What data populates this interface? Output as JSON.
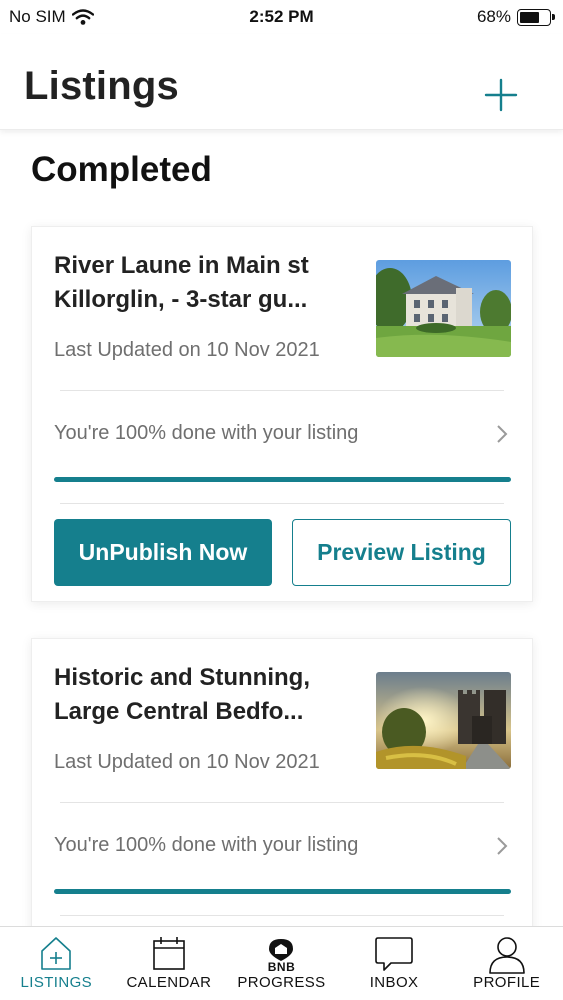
{
  "status_bar": {
    "carrier": "No SIM",
    "time": "2:52 PM",
    "battery": "68%",
    "battery_level": 0.68
  },
  "header": {
    "title": "Listings"
  },
  "section": {
    "title": "Completed"
  },
  "listings": [
    {
      "title_line1": "River Laune in Main st",
      "title_line2": "Killorglin, - 3-star gu...",
      "last_updated": "Last Updated on 10 Nov 2021",
      "progress_text": "You're 100% done with your listing",
      "progress": 1.0,
      "unpublish_label": "UnPublish Now",
      "preview_label": "Preview Listing"
    },
    {
      "title_line1": "Historic and Stunning,",
      "title_line2": "Large Central Bedfo...",
      "last_updated": "Last Updated on 10 Nov 2021",
      "progress_text": "You're 100% done with your listing",
      "progress": 1.0
    }
  ],
  "tab_bar": {
    "tabs": [
      {
        "label": "LISTINGS",
        "icon": "house-plus-icon",
        "active": true
      },
      {
        "label": "CALENDAR",
        "icon": "calendar-icon",
        "active": false
      },
      {
        "label": "PROGRESS",
        "icon": "bnb-progress-icon",
        "active": false,
        "badge": "BNB"
      },
      {
        "label": "INBOX",
        "icon": "chat-bubble-icon",
        "active": false
      },
      {
        "label": "PROFILE",
        "icon": "person-icon",
        "active": false
      }
    ]
  },
  "colors": {
    "accent": "#157f8d",
    "text": "#222222",
    "muted": "#6f6f6f"
  }
}
